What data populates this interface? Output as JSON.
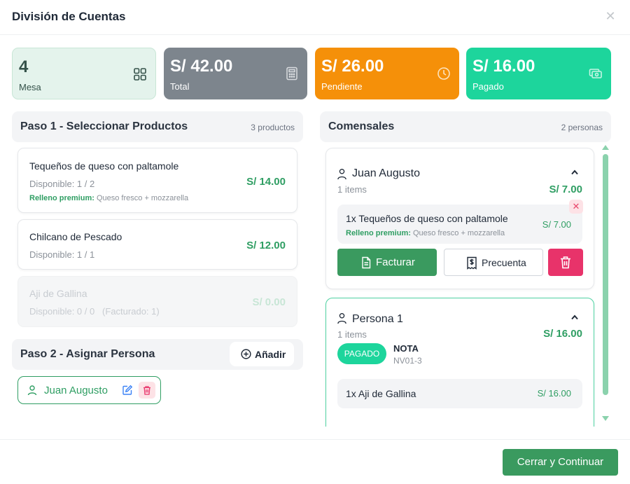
{
  "modal": {
    "title": "División de Cuentas",
    "close_icon": "close-icon"
  },
  "summary": {
    "mesa": {
      "value": "4",
      "label": "Mesa",
      "icon": "grid-icon"
    },
    "total": {
      "value": "S/ 42.00",
      "label": "Total",
      "icon": "calculator-icon"
    },
    "pendiente": {
      "value": "S/ 26.00",
      "label": "Pendiente",
      "icon": "clock-icon"
    },
    "pagado": {
      "value": "S/ 16.00",
      "label": "Pagado",
      "icon": "cash-icon"
    }
  },
  "step1": {
    "title": "Paso 1 - Seleccionar Productos",
    "count": "3 productos",
    "products": [
      {
        "name": "Tequeños de queso con paltamole",
        "available": "Disponible: 1 / 2",
        "price": "S/ 14.00",
        "note_label": "Relleno premium:",
        "note_text": "Queso fresco + mozzarella"
      },
      {
        "name": "Chilcano de Pescado",
        "available": "Disponible: 1 / 1",
        "price": "S/ 12.00"
      },
      {
        "name": "Aji de Gallina",
        "available": "Disponible: 0 / 0   (Facturado: 1)",
        "price": "S/ 0.00"
      }
    ]
  },
  "step2": {
    "title": "Paso 2 - Asignar Persona",
    "add_label": "Añadir",
    "person": "Juan Augusto"
  },
  "diners_panel": {
    "title": "Comensales",
    "count": "2 personas",
    "diners": [
      {
        "name": "Juan Augusto",
        "items": "1 items",
        "total": "S/ 7.00",
        "line": {
          "name": "1x Tequeños de queso con paltamole",
          "price": "S/ 7.00",
          "note_label": "Relleno premium:",
          "note_text": "Queso fresco + mozzarella"
        },
        "facturar_label": "Facturar",
        "precuenta_label": "Precuenta"
      },
      {
        "name": "Persona 1",
        "items": "1 items",
        "total": "S/ 16.00",
        "status": "PAGADO",
        "doc_type": "NOTA",
        "doc_number": "NV01-3",
        "line": {
          "name": "1x Aji de Gallina",
          "price": "S/ 16.00"
        }
      }
    ]
  },
  "footer": {
    "continue_label": "Cerrar y Continuar"
  },
  "colors": {
    "accent_green": "#3a9a5f",
    "pending_orange": "#f59009",
    "paid_teal": "#1dd59c",
    "total_gray": "#7d858d",
    "danger_pink": "#e8336a"
  }
}
